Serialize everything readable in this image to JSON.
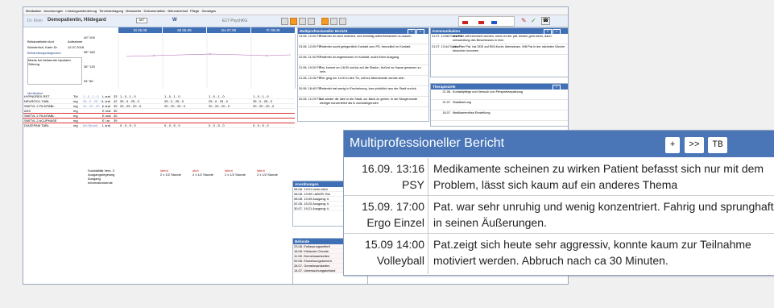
{
  "menu": [
    "Medikation",
    "Anordnungen",
    "Leistungsanforderung",
    "Terminanfragung",
    "Messwerte",
    "Dokumentation",
    "Befundverlauf",
    "Pflege",
    "Sonstiges"
  ],
  "patient": {
    "doctor": "Dr. Klein",
    "name": "Demopatientin, Hildegard",
    "sex_icon": "W",
    "ward": "E17 PsychKG",
    "status": "AKT"
  },
  "left": {
    "arzt_label": "Behandelnder Arzt",
    "arzt": "Wunderlich, Karin Dr.",
    "aufnahme_label": "Aufnahme",
    "aufnahme": "12.07.2018",
    "diag_label": "Behandlungsdiagnosen",
    "diag": "Manie bei bekannter bipolarer Störung",
    "med_label": "Medikation",
    "yaxis": [
      "40° 200",
      "38° 160",
      "36° 120",
      "34° 80"
    ]
  },
  "days": [
    "Di 05.09",
    "Mi 06.09",
    "Do 07.09",
    "Fr 08.09"
  ],
  "meds": [
    {
      "name": "HYPNOREX RET",
      "unit": "Tbl",
      "col": "1 - 0 - 1 - 0",
      "route": "L oral",
      "num": "33",
      "d": [
        "1 - 0 - 1 - 0",
        "1 - 0 - 1 - 0",
        "1 - 0 - 1 - 0",
        "1 - 0 - 1 - 0"
      ]
    },
    {
      "name": "NEUROCIL TABL",
      "unit": "mg",
      "col": "25 - 0 - 25 - 0",
      "route": "L oral",
      "num": "42",
      "d": [
        "25 - 0 - 25 - 0",
        "25 - 0 - 25 - 0",
        "25 - 0 - 25 - 0",
        "25 - 0 - 25 - 0"
      ]
    },
    {
      "name": "SMITVL 2 FILMTABL",
      "unit": "mg",
      "col": "20 - 20 - 20 - 0",
      "route": "L oral",
      "num": "39",
      "d": [
        "20 - 20 - 20 - 0",
        "20 - 20 - 20 - 0",
        "20 - 20 - 20 - 0",
        "20 - 20 - 20 - 0"
      ]
    },
    {
      "name": "ASS",
      "unit": "mg",
      "col": "",
      "route": "E oral",
      "num": "30",
      "d": [
        "",
        "",
        "",
        ""
      ]
    },
    {
      "name": "SMITVL 2 FILMTABL",
      "unit": "mg",
      "col": "",
      "route": "E oral",
      "num": "40",
      "d": [
        "",
        "",
        "",
        ""
      ]
    },
    {
      "name": "SMITVL 2 ACUPHASE",
      "unit": "mg",
      "col": "",
      "route": "E i.m.",
      "num": "39",
      "d": [
        "",
        "",
        "",
        ""
      ]
    },
    {
      "name": "DIAZEPAM TABL",
      "unit": "mg",
      "col": "bei Bedarf",
      "route": "L oral",
      "num": "",
      "d": [
        "0 - 0 - 5 - 0",
        "0 - 0 - 5 - 0",
        "0 - 0 - 5 - 0",
        "0 - 0 - 5 - 0"
      ]
    }
  ],
  "lower_left": [
    "Suizidalität Vers. 3",
    "Ausgangsregelung",
    "Ausgang",
    "Informationsende"
  ],
  "lower_vals": [
    [
      "latent",
      "2 x 1/2 Stunde"
    ],
    [
      "akut",
      "2 x 1/2 Stunde"
    ],
    [
      "latent",
      "2 x 1/2 Stunde"
    ],
    [
      "latent",
      "2 x 1/2 Stunde"
    ]
  ],
  "bg_panel": {
    "title": "Multiprofessioneller Bericht",
    "rows": [
      {
        "d": "23.08. 12:00 PD",
        "t": "Patientin ist nicht motiviert, sich freiwillig weiterbehandeln zu lassen."
      },
      {
        "d": "23.08. 12:00 PD",
        "t": "Patientin sucht gelegentlich Kontakt zum PD, freundlich im Kontakt."
      },
      {
        "d": "22.08. 11:30 PD",
        "t": "Patientin ist angemessen im Kontakt, sucht ihren Ausgang."
      },
      {
        "d": "21.08. 19:20 PD",
        "t": "Pat. kommt um 18:00 zurück auf die Station. Äußert zu Hause gewesen zu sein."
      },
      {
        "d": "21.08. 12:15 PD",
        "t": "Pat. ging um 11:00 in den TU, will zur Abendrunde zurück sein."
      },
      {
        "d": "20.08. 18:40 PD",
        "t": "Patientin trat wenig in Erscheinung, kam pünktlich aus der Stadt zurück."
      },
      {
        "d": "20.08. 12:19 PD",
        "t": "hat wieder die Idee in die Stadt, zur Bank zu gehen. In der Morgenrunde weniger konzentriert als in zurückliegenden"
      }
    ]
  },
  "komm": {
    "title": "Kommunikation",
    "rows": [
      {
        "d": "21.07. 14:58 Frei a PD",
        "t": "betreuer will informiert werden, wenn es der pat. besser geht wenn, dann umwandlung des Beschlusses in eine"
      },
      {
        "d": "21.07. 13:44 Sozi = P",
        "t": "Vater der Pat. hat SDE auf EIM-Konto überwiesen. Will Pat in der nächsten Woche besuchen kommen."
      }
    ]
  },
  "thera": {
    "title": "Therapieziele",
    "rows": [
      {
        "d": "21.08.",
        "t": "Kontaktpflege und Versuch von Perspektiveplanung"
      },
      {
        "d": "21.07.",
        "t": "Stabilisierung"
      },
      {
        "d": "18.07.",
        "t": "Medikamentöse Einstellung"
      }
    ]
  },
  "anord": {
    "title": "Anordnungen",
    "rows": [
      "08.08. 14:01 beim näch",
      "08.08. 13:59 LABOR: Blu",
      "08.08. 13:49 Ausgang: ü",
      "02.08. 15:20 Ausgang: ü",
      "30.07. 19:21 Ausgang: ü"
    ]
  },
  "befunde": {
    "title": "Befunde",
    "rows": [
      "23.08. Entlassungsmitteil",
      "18.08. Klinische Chemie",
      "11.08. Gemeinsamkeiten",
      "09.08. Einweisungsbericht",
      "28.07. Gemeinsamkeiten",
      "14.07. Untersuchungsbefund"
    ]
  },
  "popup": {
    "title": "Multiprofessioneller Bericht",
    "btn_plus": "+",
    "btn_more": ">>",
    "btn_tb": "TB",
    "rows": [
      {
        "date": "16.09. 13:16",
        "who": "PSY",
        "text": "Medikamente scheinen zu wirken Patient befasst sich nur mit dem Problem, lässt sich kaum auf ein anderes Thema"
      },
      {
        "date": "15.09. 17:00",
        "who": "Ergo Einzel",
        "text": "Pat. war sehr unruhig und wenig konzentriert. Fahrig und sprunghaft in seinen Äußerungen."
      },
      {
        "date": "15.09 14:00",
        "who": "Volleyball",
        "text": "Pat.zeigt sich heute sehr aggressiv, konnte kaum zur Teilnahme motiviert werden. Abbruch nach ca 30 Minuten."
      }
    ]
  },
  "colors": {
    "accent": "#3f6fb5",
    "popup_header": "#4a76b7",
    "toolbar_orange": "#f39a25",
    "flag_red": "#cc2222",
    "link_blue": "#2a4a8a"
  }
}
